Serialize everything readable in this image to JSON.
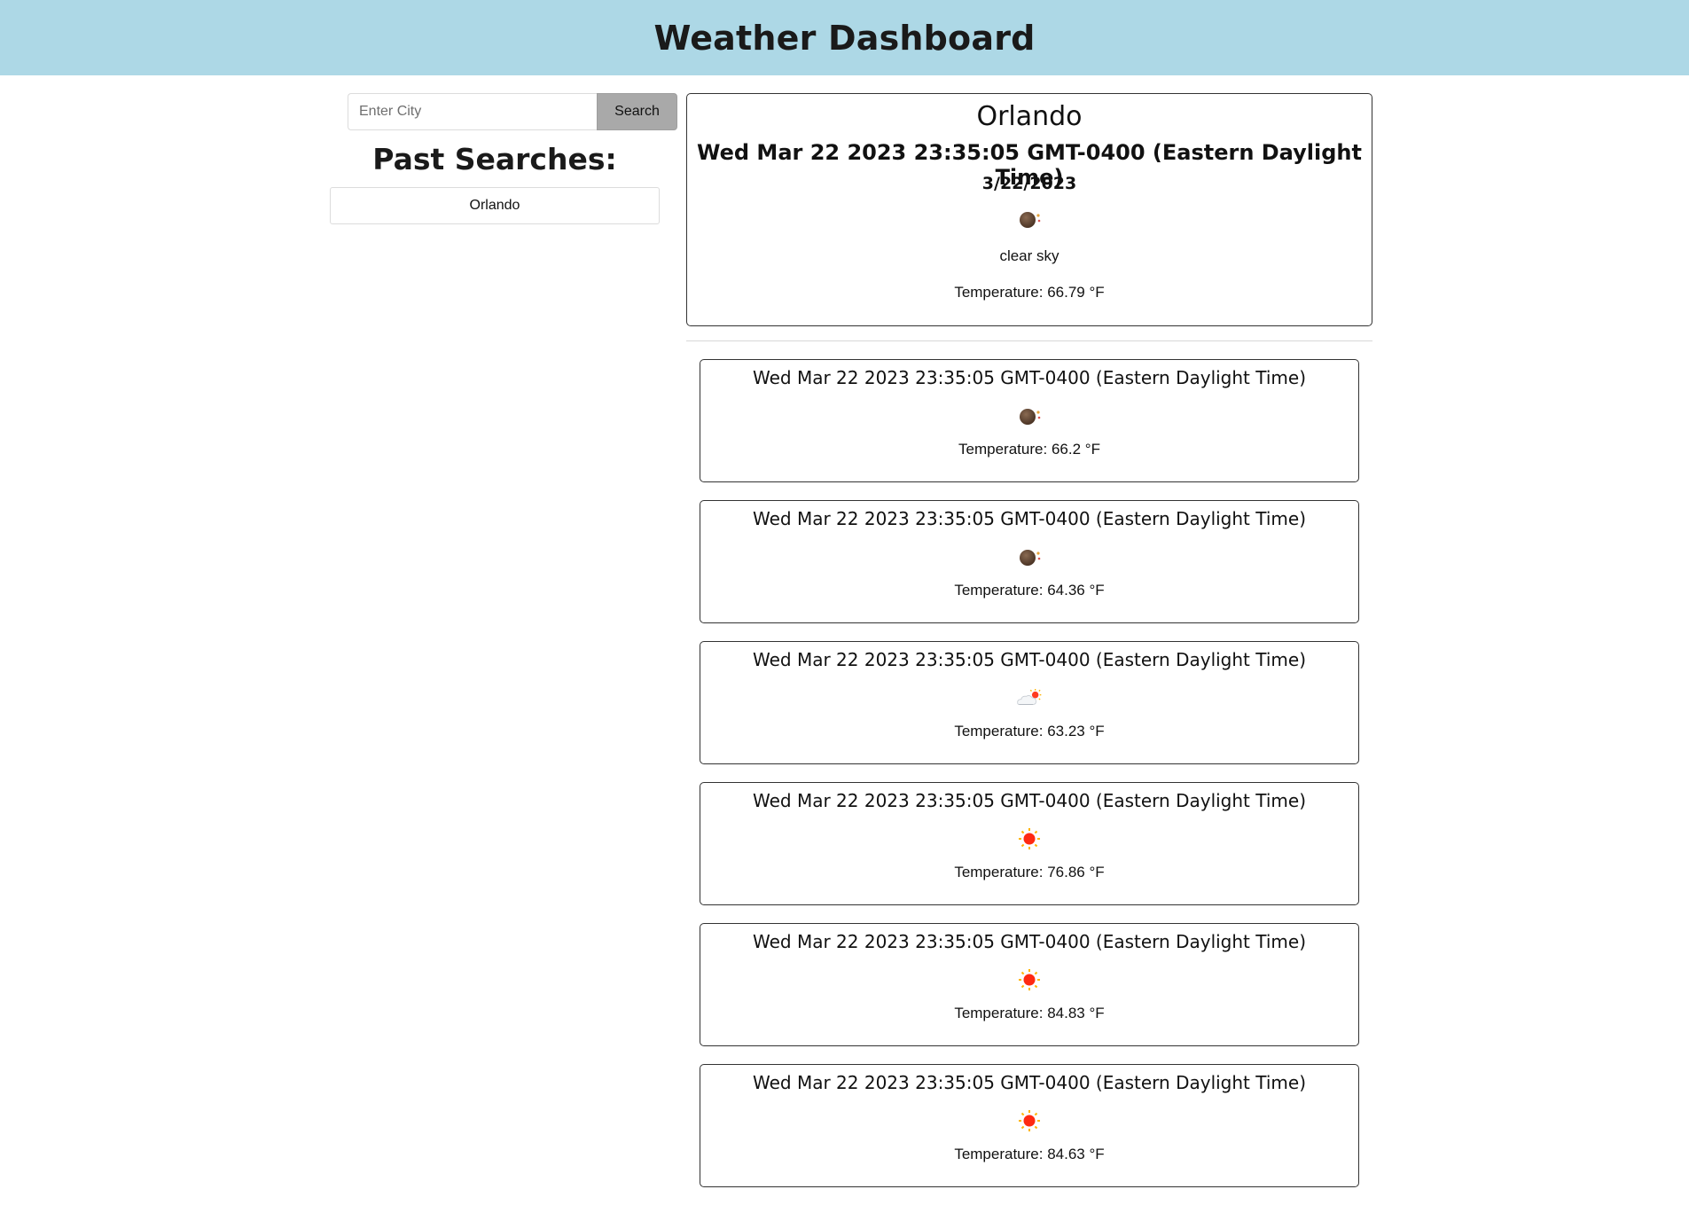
{
  "header": {
    "title": "Weather Dashboard"
  },
  "search": {
    "placeholder": "Enter City",
    "value": "",
    "button_label": "Search"
  },
  "past_searches": {
    "title": "Past Searches:",
    "items": [
      "Orlando"
    ]
  },
  "current": {
    "city": "Orlando",
    "datetime": "Wed Mar 22 2023 23:35:05 GMT-0400 (Eastern Daylight Time)",
    "date_short": "3/22/2023",
    "icon": "moon-with-stars-icon",
    "description": "clear sky",
    "temperature_label": "Temperature:",
    "temperature": "66.79",
    "unit": "°F"
  },
  "forecast": [
    {
      "datetime": "Wed Mar 22 2023 23:35:05 GMT-0400 (Eastern Daylight Time)",
      "icon": "moon-with-stars-icon",
      "temperature_label": "Temperature:",
      "temperature": "66.2",
      "unit": "°F"
    },
    {
      "datetime": "Wed Mar 22 2023 23:35:05 GMT-0400 (Eastern Daylight Time)",
      "icon": "moon-with-stars-icon",
      "temperature_label": "Temperature:",
      "temperature": "64.36",
      "unit": "°F"
    },
    {
      "datetime": "Wed Mar 22 2023 23:35:05 GMT-0400 (Eastern Daylight Time)",
      "icon": "cloud-with-sun-icon",
      "temperature_label": "Temperature:",
      "temperature": "63.23",
      "unit": "°F"
    },
    {
      "datetime": "Wed Mar 22 2023 23:35:05 GMT-0400 (Eastern Daylight Time)",
      "icon": "sun-icon",
      "temperature_label": "Temperature:",
      "temperature": "76.86",
      "unit": "°F"
    },
    {
      "datetime": "Wed Mar 22 2023 23:35:05 GMT-0400 (Eastern Daylight Time)",
      "icon": "sun-icon",
      "temperature_label": "Temperature:",
      "temperature": "84.83",
      "unit": "°F"
    },
    {
      "datetime": "Wed Mar 22 2023 23:35:05 GMT-0400 (Eastern Daylight Time)",
      "icon": "sun-icon",
      "temperature_label": "Temperature:",
      "temperature": "84.63",
      "unit": "°F"
    }
  ],
  "colors": {
    "header_bg": "#add8e6",
    "search_button_bg": "#a9a9a9",
    "card_border": "#333333"
  }
}
